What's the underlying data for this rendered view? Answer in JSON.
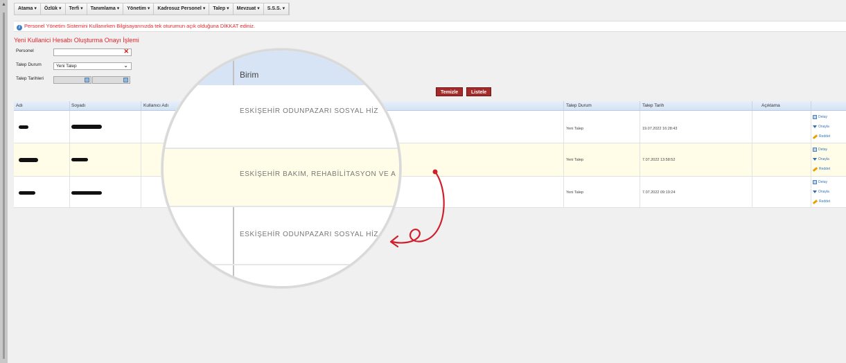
{
  "menu": [
    {
      "label": "Atama",
      "caret": "▾"
    },
    {
      "label": "Özlük",
      "caret": "▾"
    },
    {
      "label": "Terfi",
      "caret": "▾"
    },
    {
      "label": "Tanımlama",
      "caret": "▾"
    },
    {
      "label": "Yönetim",
      "caret": "▾"
    },
    {
      "label": "Kadrosuz Personel",
      "caret": "▾"
    },
    {
      "label": "Talep",
      "caret": "▾"
    },
    {
      "label": "Mevzuat",
      "caret": "▾"
    },
    {
      "label": "S.S.S.",
      "caret": "▾"
    }
  ],
  "notice": "Personel Yönetim Sistemini Kullanırken Bilgisayarınızda tek oturumun açık olduğuna DİKKAT ediniz.",
  "page_title": "Yeni Kullanici Hesabı Oluşturma Onayı İşlemi",
  "form": {
    "personel_label": "Personel",
    "personel_value": "",
    "talep_durum_label": "Talep Durum",
    "talep_durum_value": "Yeni Talep",
    "talep_tarihleri_label": "Talep Tarihleri"
  },
  "buttons": {
    "temizle": "Temizle",
    "listele": "Listele"
  },
  "grid": {
    "headers": {
      "adi": "Adı",
      "soyadi": "Soyadı",
      "kullanici_adi": "Kullanıcı Adı",
      "talep_durum": "Talep Durum",
      "talep_tarih": "Talep Tarih",
      "aciklama": "Açıklama"
    },
    "rows": [
      {
        "status": "Yeni Talep",
        "date": "19.07.2022 16:28:43"
      },
      {
        "status": "Yeni Talep",
        "date": "7.07.2022 13:58:52"
      },
      {
        "status": "Yeni Talep",
        "date": "7.07.2022 09:19:24"
      }
    ],
    "actions": {
      "detay": "Detay",
      "onayla": "Onayla",
      "reddet": "Reddet"
    }
  },
  "magnifier": {
    "header": "Birim",
    "rows": [
      "ESKİŞEHİR ODUNPAZARI SOSYAL HİZ",
      "ESKİŞEHİR BAKIM, REHABİLİTASYON VE A",
      "ESKİŞEHİR ODUNPAZARI SOSYAL HİZ"
    ]
  },
  "colors": {
    "accent_red": "#e2242a",
    "button_red": "#a52b2b",
    "header_blue": "#d4e2f4",
    "highlight_row": "#fffde8",
    "annotation": "#d01f2b"
  }
}
